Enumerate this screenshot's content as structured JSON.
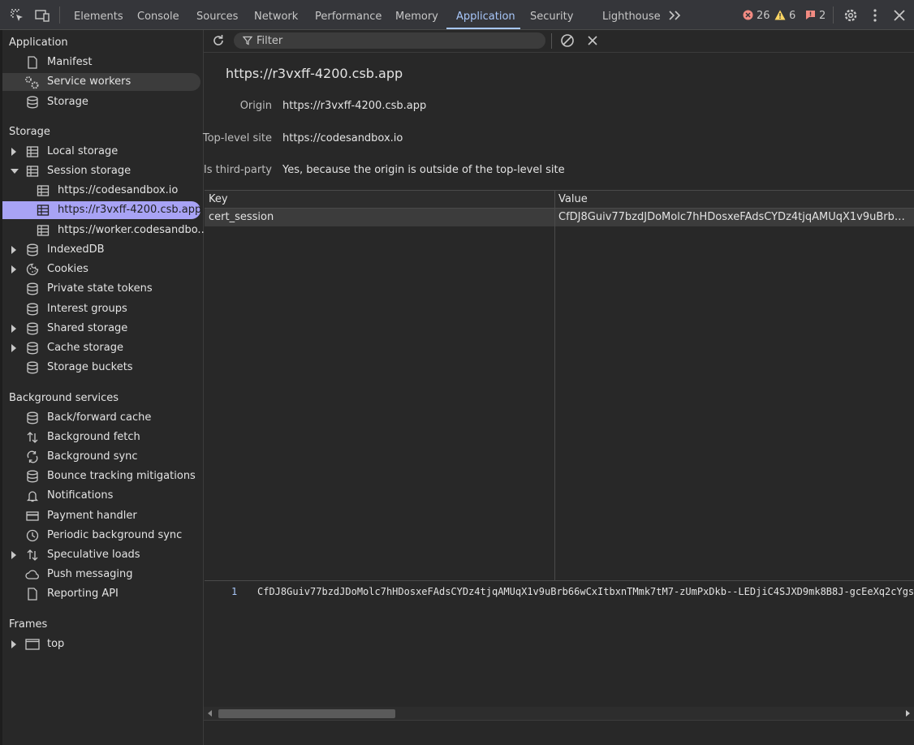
{
  "toolbar": {
    "tabs": [
      "Elements",
      "Console",
      "Sources",
      "Network",
      "Performance",
      "Memory",
      "Application",
      "Security",
      "Lighthouse"
    ],
    "active_tab": "Application",
    "errors": "26",
    "warnings": "6",
    "issues": "2"
  },
  "sidebar": {
    "application": {
      "heading": "Application",
      "items": [
        "Manifest",
        "Service workers",
        "Storage"
      ]
    },
    "storage": {
      "heading": "Storage",
      "local_storage": "Local storage",
      "session_storage": "Session storage",
      "session_children": [
        "https://codesandbox.io",
        "https://r3vxff-4200.csb.app",
        "https://worker.codesandbo..."
      ],
      "rest": [
        "IndexedDB",
        "Cookies",
        "Private state tokens",
        "Interest groups",
        "Shared storage",
        "Cache storage",
        "Storage buckets"
      ]
    },
    "background": {
      "heading": "Background services",
      "items": [
        "Back/forward cache",
        "Background fetch",
        "Background sync",
        "Bounce tracking mitigations",
        "Notifications",
        "Payment handler",
        "Periodic background sync",
        "Speculative loads",
        "Push messaging",
        "Reporting API"
      ]
    },
    "frames": {
      "heading": "Frames",
      "items": [
        "top"
      ]
    }
  },
  "main": {
    "filter_placeholder": "Filter",
    "origin_title": "https://r3vxff-4200.csb.app",
    "meta": [
      {
        "label": "Origin",
        "value": "https://r3vxff-4200.csb.app"
      },
      {
        "label": "Top-level site",
        "value": "https://codesandbox.io"
      },
      {
        "label": "Is third-party",
        "value": "Yes, because the origin is outside of the top-level site"
      }
    ],
    "grid": {
      "headers": [
        "Key",
        "Value"
      ],
      "rows": [
        {
          "key": "cert_session",
          "value": "CfDJ8Guiv77bzdJDoMolc7hHDosxeFAdsCYDz4tjqAMUqX1v9uBrb66w..."
        }
      ]
    },
    "preview": {
      "line_number": "1",
      "text": "CfDJ8Guiv77bzdJDoMolc7hHDosxeFAdsCYDz4tjqAMUqX1v9uBrb66wCxItbxnTMmk7tM7-zUmPxDkb--LEDjiC4SJXD9mk8B8J-gcEeXq2cYgs"
    }
  },
  "colors": {
    "accent": "#a8c7fa",
    "selected_bg": "#a8a3f5",
    "error": "#f28b82",
    "warning": "#fdd663"
  }
}
